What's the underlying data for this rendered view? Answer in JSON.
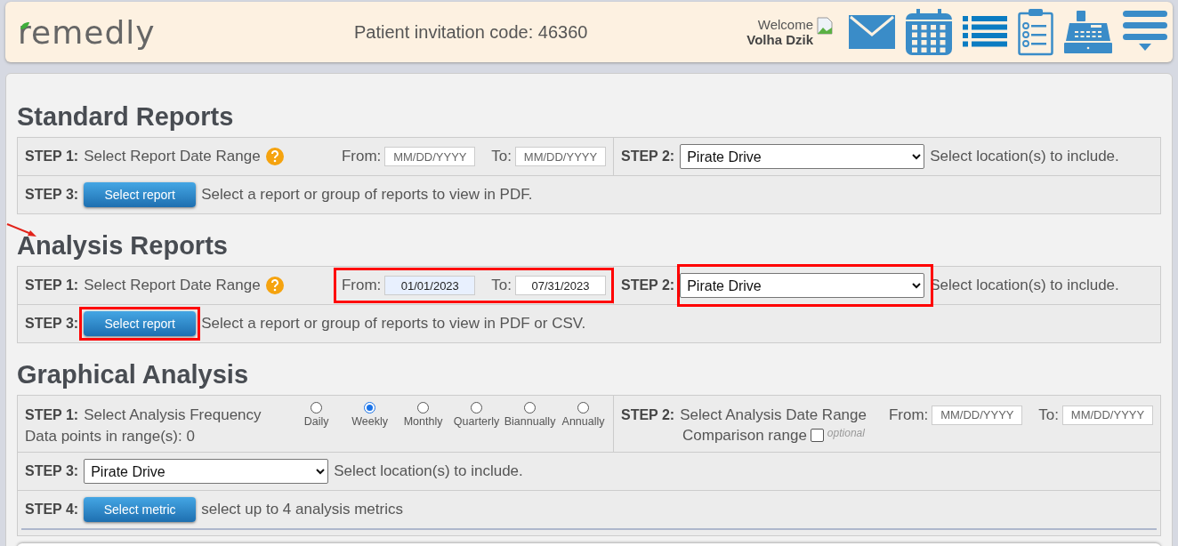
{
  "header": {
    "logo": "remedly",
    "invitation": "Patient invitation code: 46360",
    "welcome": "Welcome",
    "user": "Volha Dzik"
  },
  "sections": [
    {
      "title": "Standard Reports",
      "arrow": false,
      "rows": [
        {
          "cells": [
            {
              "step": "STEP 1:",
              "items": [
                {
                  "kind": "text",
                  "text": "Select Report Date Range"
                },
                {
                  "kind": "help"
                },
                {
                  "kind": "date_range",
                  "highlighted": false,
                  "from_label": "From:",
                  "from": {
                    "placeholder": "MM/DD/YYYY",
                    "autofill": false
                  },
                  "to_label": "To:",
                  "to": {
                    "placeholder": "MM/DD/YYYY",
                    "autofill": false
                  }
                }
              ]
            },
            {
              "step": "STEP 2:",
              "items": [
                {
                  "kind": "select",
                  "value": "Pirate Drive",
                  "highlighted": false
                },
                {
                  "kind": "text",
                  "text": "Select location(s) to include."
                }
              ]
            }
          ]
        },
        {
          "cells": [
            {
              "step": "STEP 3:",
              "items": [
                {
                  "kind": "button",
                  "label": "Select report",
                  "highlighted": false
                },
                {
                  "kind": "text",
                  "text": "Select a report or group of reports to view in PDF."
                }
              ]
            }
          ]
        }
      ]
    },
    {
      "title": "Analysis Reports",
      "arrow": true,
      "rows": [
        {
          "cells": [
            {
              "step": "STEP 1:",
              "items": [
                {
                  "kind": "text",
                  "text": "Select Report Date Range"
                },
                {
                  "kind": "help"
                },
                {
                  "kind": "date_range",
                  "highlighted": true,
                  "from_label": "From:",
                  "from": {
                    "value": "01/01/2023",
                    "autofill": true
                  },
                  "to_label": "To:",
                  "to": {
                    "value": "07/31/2023",
                    "autofill": false
                  }
                }
              ]
            },
            {
              "step": "STEP 2:",
              "items": [
                {
                  "kind": "select",
                  "value": "Pirate Drive",
                  "highlighted": true
                },
                {
                  "kind": "text",
                  "text": "Select location(s) to include."
                }
              ]
            }
          ]
        },
        {
          "cells": [
            {
              "step": "STEP 3:",
              "items": [
                {
                  "kind": "button",
                  "label": "Select report",
                  "highlighted": true
                },
                {
                  "kind": "text",
                  "text": "Select a report or group of reports to view in PDF or CSV."
                }
              ]
            }
          ]
        }
      ]
    },
    {
      "title": "Graphical Analysis",
      "arrow": false,
      "rows": [
        {
          "cells": [
            {
              "step": "STEP 1:",
              "items": [
                {
                  "kind": "text",
                  "text": "Select Analysis Frequency"
                },
                {
                  "kind": "radio_group",
                  "options": [
                    {
                      "label": "Daily",
                      "selected": false
                    },
                    {
                      "label": "Weekly",
                      "selected": true
                    },
                    {
                      "label": "Monthly",
                      "selected": false
                    },
                    {
                      "label": "Quarterly",
                      "selected": false
                    },
                    {
                      "label": "Biannually",
                      "selected": false
                    },
                    {
                      "label": "Annually",
                      "selected": false
                    }
                  ]
                }
              ],
              "note": {
                "kind": "text",
                "text": "Data points in range(s): 0"
              }
            },
            {
              "step": "STEP 2:",
              "items": [
                {
                  "kind": "text",
                  "text": "Select Analysis Date Range"
                },
                {
                  "kind": "date_range",
                  "highlighted": false,
                  "from_label": "From:",
                  "from": {
                    "placeholder": "MM/DD/YYYY",
                    "autofill": false
                  },
                  "to_label": "To:",
                  "to": {
                    "placeholder": "MM/DD/YYYY",
                    "autofill": false
                  }
                }
              ],
              "note": {
                "kind": "checkbox",
                "label": "Comparison range",
                "checked": false,
                "hint": "optional"
              }
            }
          ]
        },
        {
          "cells": [
            {
              "step": "STEP 3:",
              "items": [
                {
                  "kind": "select",
                  "value": "Pirate Drive",
                  "highlighted": false
                },
                {
                  "kind": "text",
                  "text": "Select location(s) to include."
                }
              ]
            }
          ]
        },
        {
          "cells": [
            {
              "step": "STEP 4:",
              "items": [
                {
                  "kind": "button",
                  "label": "Select metric",
                  "highlighted": false
                },
                {
                  "kind": "text",
                  "text": "select up to 4 analysis metrics"
                }
              ]
            }
          ]
        }
      ]
    }
  ]
}
